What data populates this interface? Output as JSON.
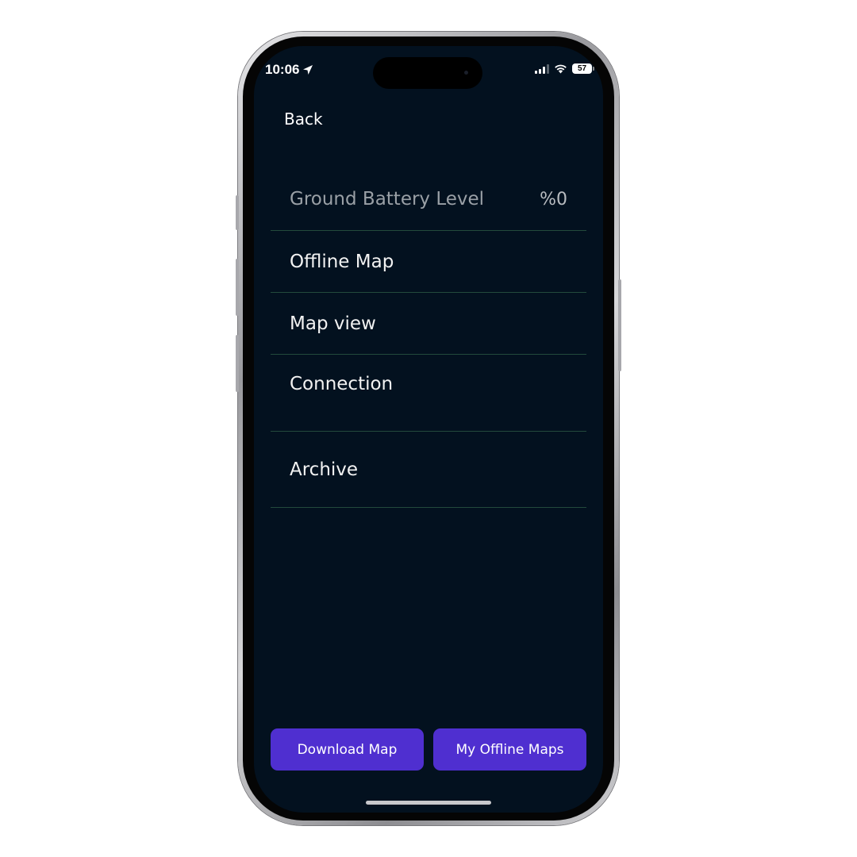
{
  "status_bar": {
    "time": "10:06",
    "battery": "57"
  },
  "nav": {
    "back_label": "Back"
  },
  "menu": {
    "items": [
      {
        "label": "Ground Battery Level",
        "value": "%0"
      },
      {
        "label": "Offline Map"
      },
      {
        "label": "Map view"
      },
      {
        "label": "Connection"
      },
      {
        "label": "Archive"
      }
    ]
  },
  "actions": {
    "download_label": "Download Map",
    "my_maps_label": "My Offline Maps"
  },
  "colors": {
    "background": "#03111f",
    "divider": "#234a3c",
    "button": "#4f2fd0"
  },
  "icons": [
    "location-arrow-icon",
    "cellular-signal-icon",
    "wifi-icon",
    "battery-icon"
  ]
}
